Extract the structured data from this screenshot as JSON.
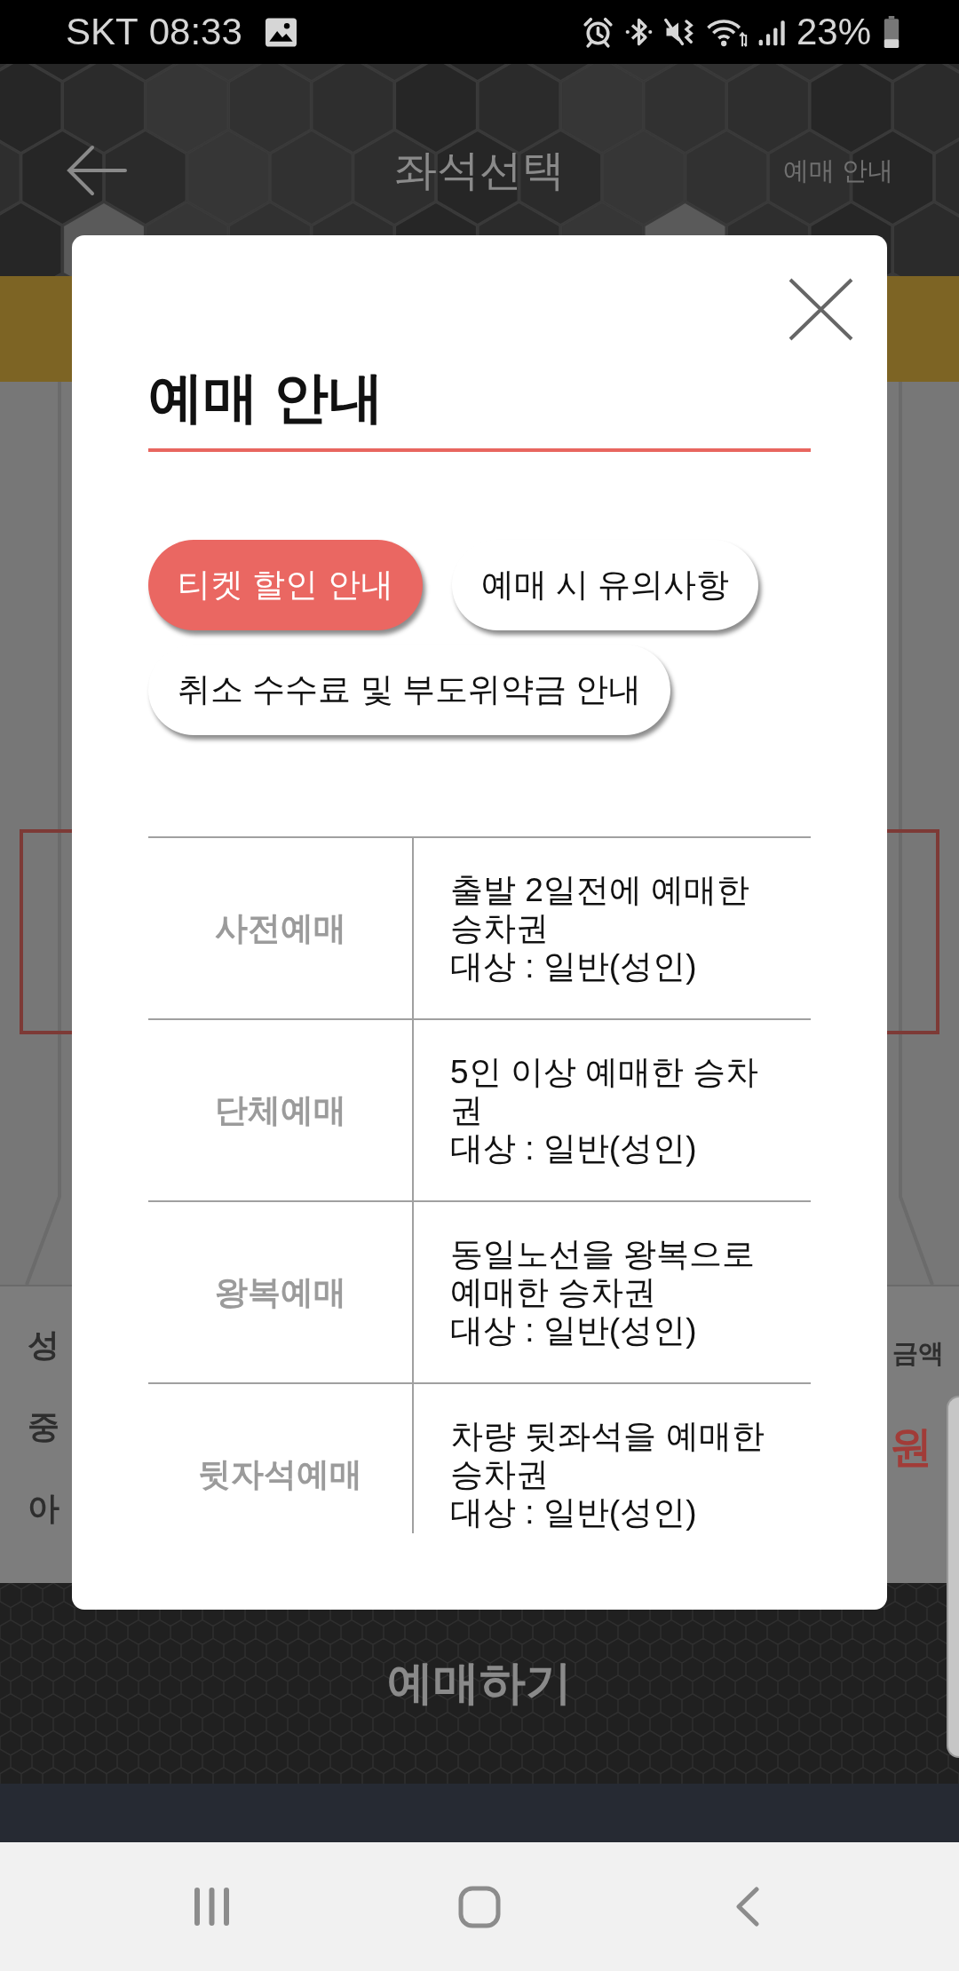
{
  "status_bar": {
    "carrier": "SKT",
    "time": "08:33",
    "battery": "23%"
  },
  "header": {
    "title": "좌석선택",
    "action": "예매 안내"
  },
  "fare_panel": {
    "labels": [
      "성",
      "중",
      "아"
    ],
    "total_label": "금액",
    "total_amount": "원"
  },
  "book_button": {
    "label": "예매하기"
  },
  "modal": {
    "title": "예매 안내",
    "tabs": [
      {
        "label": "티켓 할인 안내",
        "selected": true
      },
      {
        "label": "예매 시 유의사항",
        "selected": false
      },
      {
        "label": "취소 수수료 및 부도위약금 안내",
        "selected": false
      }
    ],
    "table": {
      "rows": [
        {
          "type": "사전예매",
          "description": "출발 2일전에 예매한 승차권",
          "eligibility": "대상 : 일반(성인)"
        },
        {
          "type": "단체예매",
          "description": "5인 이상 예매한 승차권",
          "eligibility": "대상 : 일반(성인)"
        },
        {
          "type": "왕복예매",
          "description": "동일노선을 왕복으로 예매한 승차권",
          "eligibility": "대상 : 일반(성인)"
        },
        {
          "type": "뒷자석예매",
          "description": "차량 뒷좌석을 예매한 승차권",
          "eligibility": "대상 : 일반(성인)"
        }
      ]
    }
  }
}
